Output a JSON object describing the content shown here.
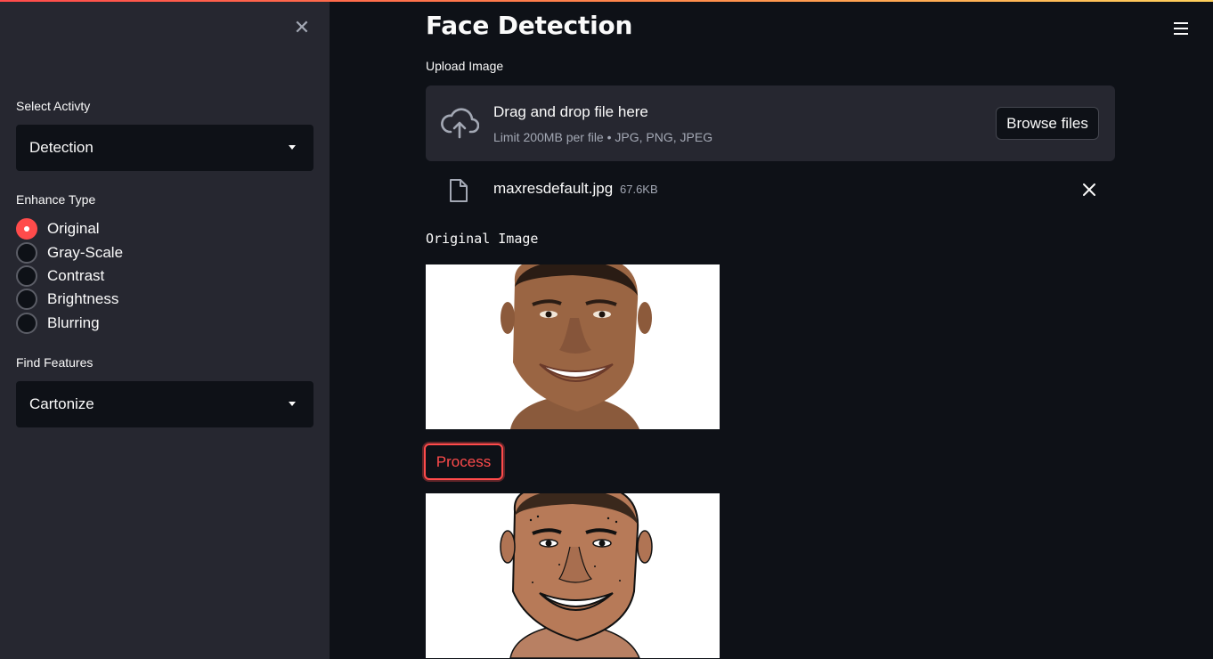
{
  "sidebar": {
    "select_activity_label": "Select Activty",
    "select_activity_value": "Detection",
    "enhance_type_label": "Enhance Type",
    "enhance_options": [
      {
        "label": "Original",
        "checked": true
      },
      {
        "label": "Gray-Scale",
        "checked": false
      },
      {
        "label": "Contrast",
        "checked": false
      },
      {
        "label": "Brightness",
        "checked": false
      },
      {
        "label": "Blurring",
        "checked": false
      }
    ],
    "find_features_label": "Find Features",
    "find_features_value": "Cartonize"
  },
  "main": {
    "title": "Face Detection",
    "upload_label": "Upload Image",
    "dropzone_title": "Drag and drop file here",
    "dropzone_limit": "Limit 200MB per file • JPG, PNG, JPEG",
    "browse_label": "Browse files",
    "file_name": "maxresdefault.jpg",
    "file_size": "67.6KB",
    "original_image_label": "Original Image",
    "process_label": "Process"
  },
  "colors": {
    "accent": "#ff4b4b",
    "background": "#0e1117",
    "sidebar": "#262730"
  },
  "icons": [
    "close-icon",
    "chevron-down-icon",
    "menu-icon",
    "cloud-upload-icon",
    "file-icon",
    "remove-file-icon"
  ]
}
